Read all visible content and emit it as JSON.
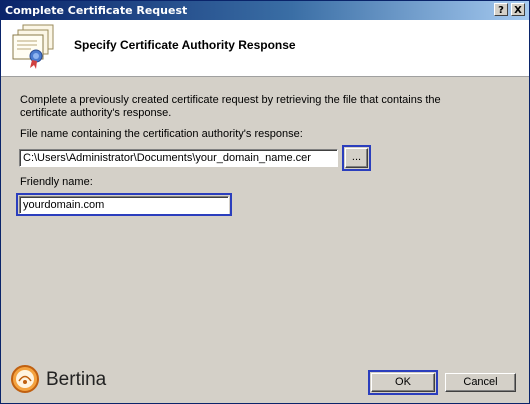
{
  "window": {
    "title": "Complete Certificate Request",
    "help_button": "?",
    "close_button": "X"
  },
  "header": {
    "heading": "Specify Certificate Authority Response"
  },
  "form": {
    "description": "Complete a previously created certificate request by retrieving the file that contains the certificate authority's response.",
    "file_label": "File name containing the certification authority's response:",
    "file_value": "C:\\Users\\Administrator\\Documents\\your_domain_name.cer",
    "browse_label": "...",
    "friendly_label": "Friendly name:",
    "friendly_value": "yourdomain.com"
  },
  "footer": {
    "logo_text": "Bertina",
    "ok_label": "OK",
    "cancel_label": "Cancel"
  },
  "colors": {
    "highlight": "#2b3ebd",
    "titlebar": "#0a246a"
  }
}
